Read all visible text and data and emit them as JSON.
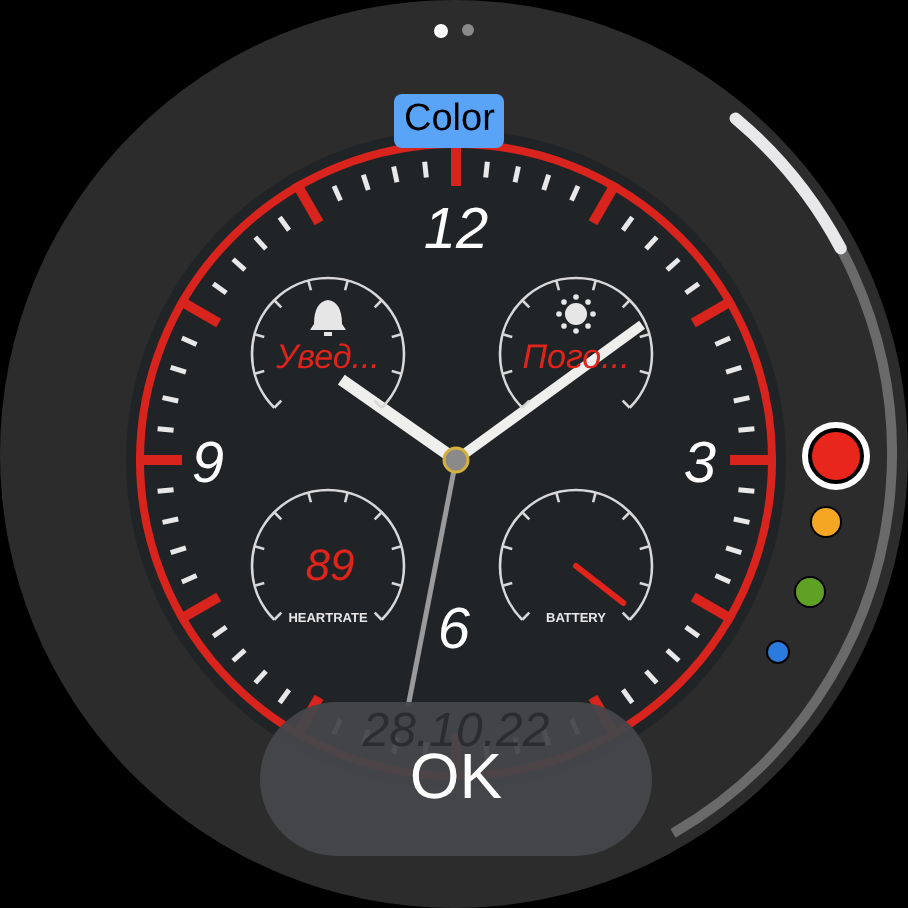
{
  "pager": [
    {
      "selected": true
    },
    {
      "selected": false
    }
  ],
  "title": "Color",
  "numerals": [
    "12",
    "3",
    "6",
    "9"
  ],
  "subdials": [
    {
      "kind": "text",
      "label": "Увед..."
    },
    {
      "kind": "text",
      "label": "Пого..."
    },
    {
      "kind": "value",
      "value": "89",
      "caption": "HEARTRATE"
    },
    {
      "kind": "needle",
      "caption": "BATTERY"
    }
  ],
  "date": "28.10.22",
  "colors": [
    {
      "color": "#e8261c",
      "selected": true
    },
    {
      "color": "#f5a623",
      "selected": false
    },
    {
      "color": "#5fa125",
      "selected": false
    },
    {
      "color": "#2a7be0",
      "selected": false
    }
  ],
  "button": "OK"
}
